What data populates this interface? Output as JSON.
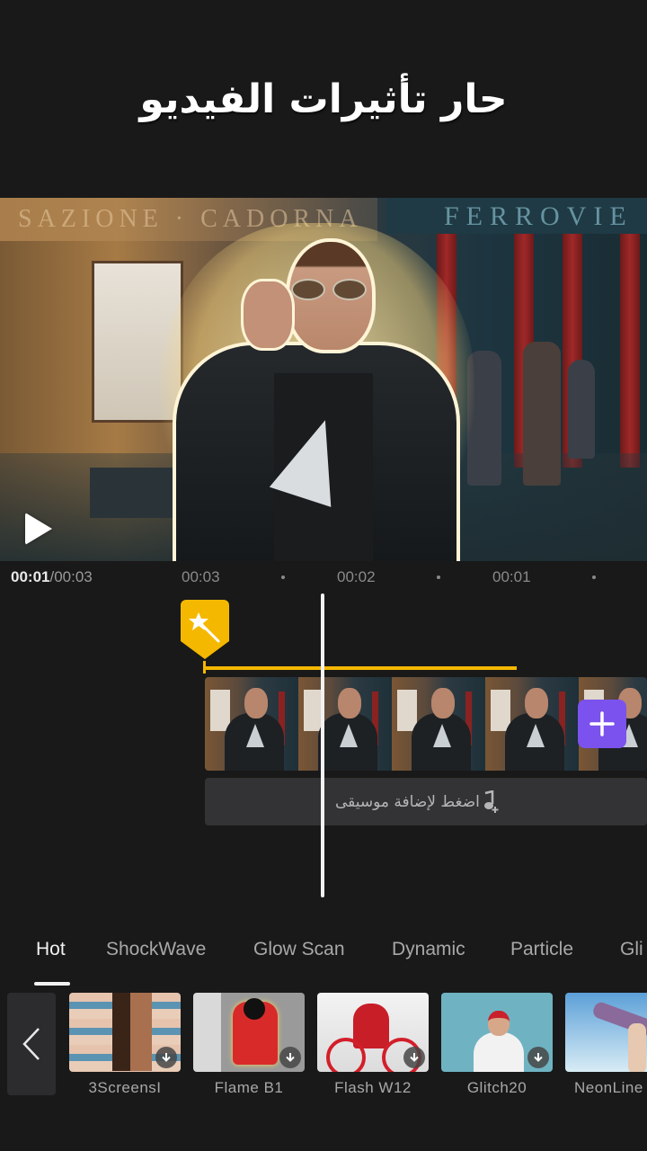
{
  "headline": "حار تأثيرات الفيديو",
  "preview": {
    "sign_left": "SAZIONE · CADORNA",
    "sign_right": "FERROVIE",
    "play_icon": "play-icon"
  },
  "timeline": {
    "current_time": "00:01",
    "total_time": "/00:03",
    "ruler_ticks": [
      "00:03",
      "00:02",
      "00:01"
    ],
    "effect_icon": "magic-wand-icon",
    "effect_color": "#f5b800",
    "add_clip_icon": "plus-icon",
    "add_clip_color": "#7b52ee",
    "music_label": "اضغط لإضافة موسيقى",
    "music_icon": "music-note-add-icon"
  },
  "categories": {
    "active": "Hot",
    "tabs": [
      "Hot",
      "ShockWave",
      "Glow Scan",
      "Dynamic",
      "Particle",
      "Gli"
    ]
  },
  "effects": {
    "back_icon": "chevron-left-icon",
    "items": [
      {
        "name": "3ScreensI",
        "downloadable": true
      },
      {
        "name": "Flame B1",
        "downloadable": true
      },
      {
        "name": "Flash W12",
        "downloadable": true
      },
      {
        "name": "Glitch20",
        "downloadable": true
      },
      {
        "name": "NeonLine",
        "downloadable": false
      }
    ]
  }
}
